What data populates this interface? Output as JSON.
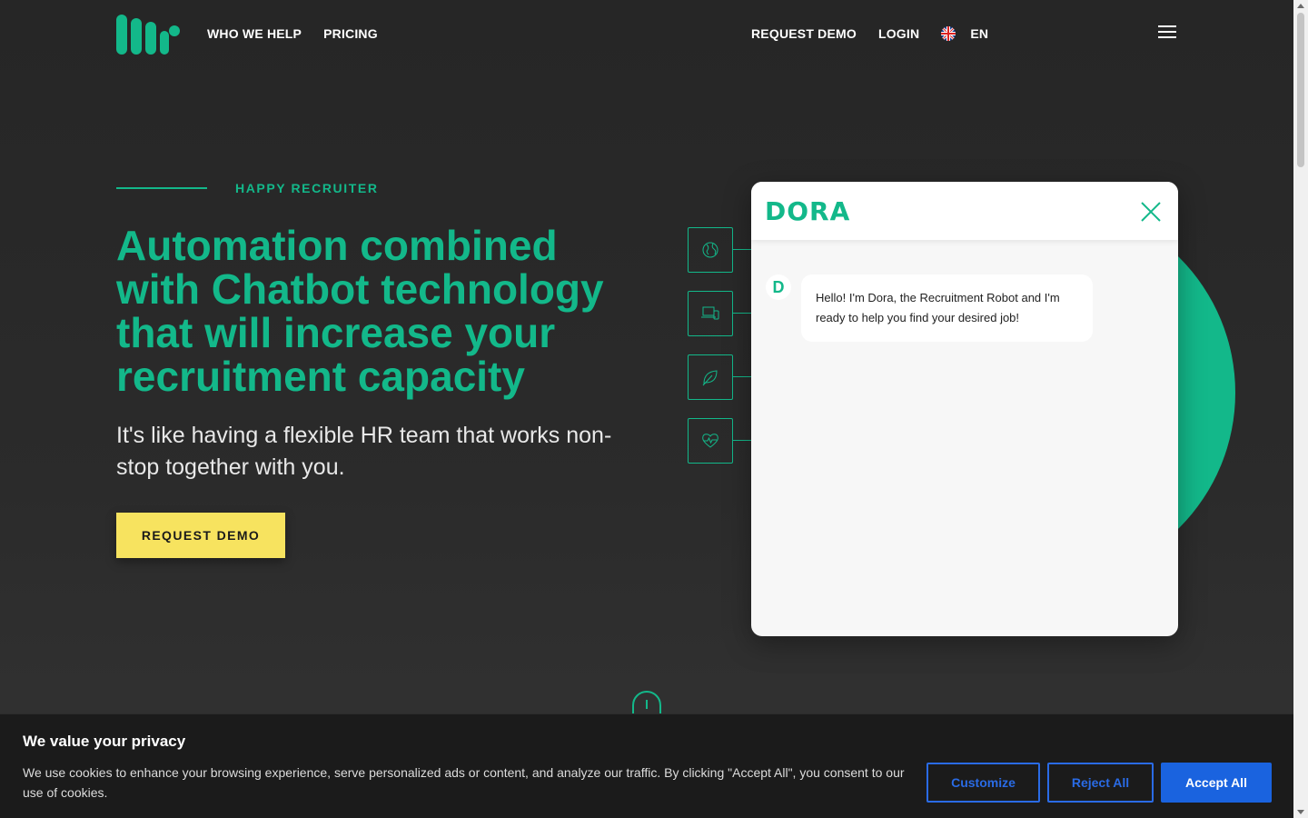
{
  "header": {
    "nav_left": [
      "WHO WE HELP",
      "PRICING"
    ],
    "request_demo": "REQUEST DEMO",
    "login": "LOGIN",
    "language": "EN"
  },
  "hero": {
    "eyebrow": "HAPPY RECRUITER",
    "title": "Automation combined with Chatbot technology that will increase your recruitment capacity",
    "subtitle": "It's like having a flexible HR team that works non-stop together with you.",
    "cta": "REQUEST DEMO"
  },
  "side_icons": [
    "globe-icon",
    "devices-icon",
    "leaf-icon",
    "heart-pulse-icon"
  ],
  "chat": {
    "brand": "DORA",
    "avatar_letter": "D",
    "message": "Hello! I'm Dora, the Recruitment Robot and I'm ready to help you find your desired job!"
  },
  "cookie": {
    "title": "We value your privacy",
    "text": "We use cookies to enhance your browsing experience, serve personalized ads or content, and analyze our traffic. By clicking \"Accept All\", you consent to our use of cookies.",
    "customize": "Customize",
    "reject": "Reject All",
    "accept": "Accept All"
  },
  "colors": {
    "accent": "#13b88a",
    "cta": "#f7e35f",
    "background": "#2a2a2a",
    "cookie_button": "#1a63df"
  }
}
